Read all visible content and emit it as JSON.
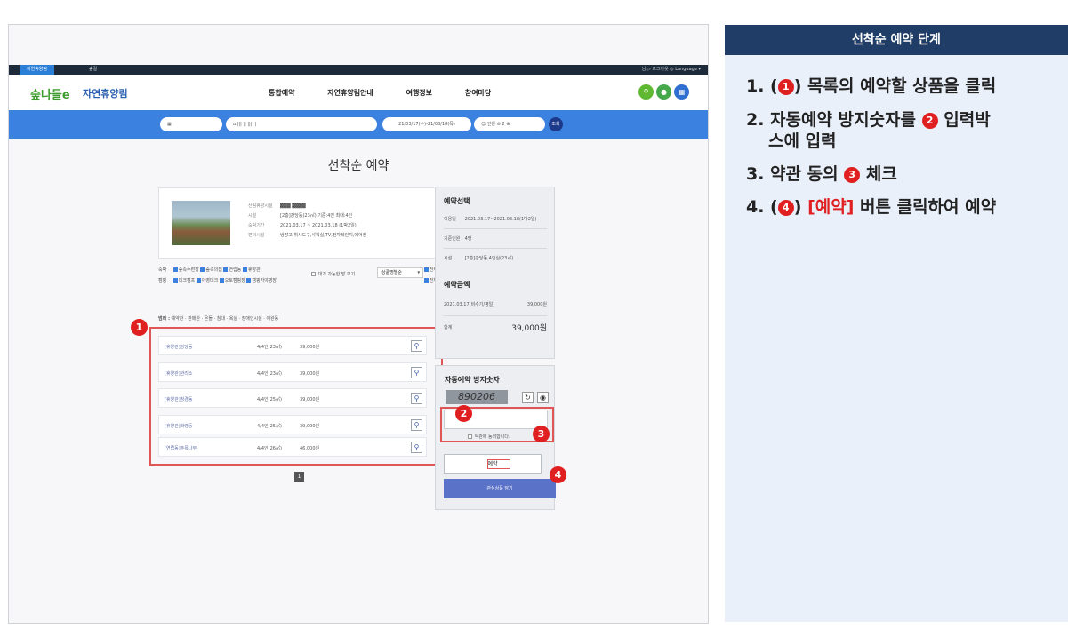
{
  "topbar": {
    "tab_active": "자연휴양림",
    "tab_second": "숲길",
    "right": "님 ▷ 로그아웃 ◎ Language ▾"
  },
  "gnb": {
    "logo": "숲나들e",
    "site_name": "자연휴양림",
    "menu": [
      "통합예약",
      "자연휴양림안내",
      "여행정보",
      "참여마당"
    ]
  },
  "searchbar": {
    "dates": "21/03/17(수)-21/03/18(목)",
    "people": "인원",
    "count": "2",
    "search": "조회"
  },
  "page_title": "선착순 예약",
  "product": {
    "rows": [
      {
        "k": "산림휴양시설",
        "v": ""
      },
      {
        "k": "시설",
        "v": "[2층]강당동(23㎡) 기준:4인 최대:4인"
      },
      {
        "k": "숙박기간",
        "v": "2021.03.17 ~ 2021.03.18 (1박2일)"
      },
      {
        "k": "편의시설",
        "v": "냉장고,취사도구,샤워실,TV,전자레인지,에어컨"
      }
    ],
    "wait_label": "대기 가능한 방 보기",
    "sort": "상품명별순"
  },
  "filters": {
    "row1_label": "숙박",
    "row1": [
      "숲속수련장",
      "숲속의집",
      "연립동",
      "휴양관"
    ],
    "row2_label": "캠핑",
    "row2": [
      "데크캠프",
      "야영데크",
      "오토캠핑장",
      "캠핑카야영장"
    ],
    "all": "전체"
  },
  "legend": {
    "label": "범례 :",
    "items": [
      "예약완",
      "판매완",
      "온돌",
      "침대",
      "욕실",
      "장애인시설",
      "애완동"
    ]
  },
  "results": [
    {
      "name": "[휴양관]강당동",
      "cap": "4/4인(23㎡)",
      "price": "39,000원"
    },
    {
      "name": "[휴양관]관리소",
      "cap": "4/4인(23㎡)",
      "price": "39,000원"
    },
    {
      "name": "[휴양관]창경동",
      "cap": "4/4인(25㎡)",
      "price": "39,000원"
    },
    {
      "name": "[휴양관]화령동",
      "cap": "4/4인(25㎡)",
      "price": "39,000원"
    },
    {
      "name": "[연립동]주목나무",
      "cap": "4/4인(26㎡)",
      "price": "46,000원"
    }
  ],
  "pager": "1",
  "side": {
    "selection_title": "예약선택",
    "use_date_k": "이용일",
    "use_date_v": "2021.03.17~2021.03.18(1박2일)",
    "people_k": "기준인원",
    "people_v": "4명",
    "facility_k": "시설",
    "facility_v": "[2층]강당동,4인실(23㎡)",
    "amount_title": "예약금액",
    "amount_k": "2021.03.17(비수기/평일)",
    "amount_v": "39,000원",
    "total_k": "합계",
    "total_v": "39,000원"
  },
  "captcha": {
    "title": "자동예약 방지숫자",
    "code": "890206",
    "agree": "약관에 동의합니다.",
    "reserve": "예약",
    "cart": "관심상품 담기"
  },
  "badges": [
    "1",
    "2",
    "3",
    "4"
  ],
  "instructions": {
    "title": "선착순 예약 단계",
    "step1_pre": "1. (",
    "step1_post": ") 목록의 예약할 상품을 클릭",
    "step2_pre": "2. 자동예약 방지숫자를",
    "step2_post": "입력박",
    "step2_line2": "스에 입력",
    "step3_pre": "3. 약관 동의",
    "step3_post": "체크",
    "step4_pre": "4. (",
    "step4_red": "[예약]",
    "step4_post": "버튼 클릭하여 예약"
  },
  "colors": {
    "accent_blue": "#3b82e0",
    "marker_red": "#e02020",
    "header_navy": "#1f3d66",
    "panel_bg": "#e9f0fa"
  }
}
